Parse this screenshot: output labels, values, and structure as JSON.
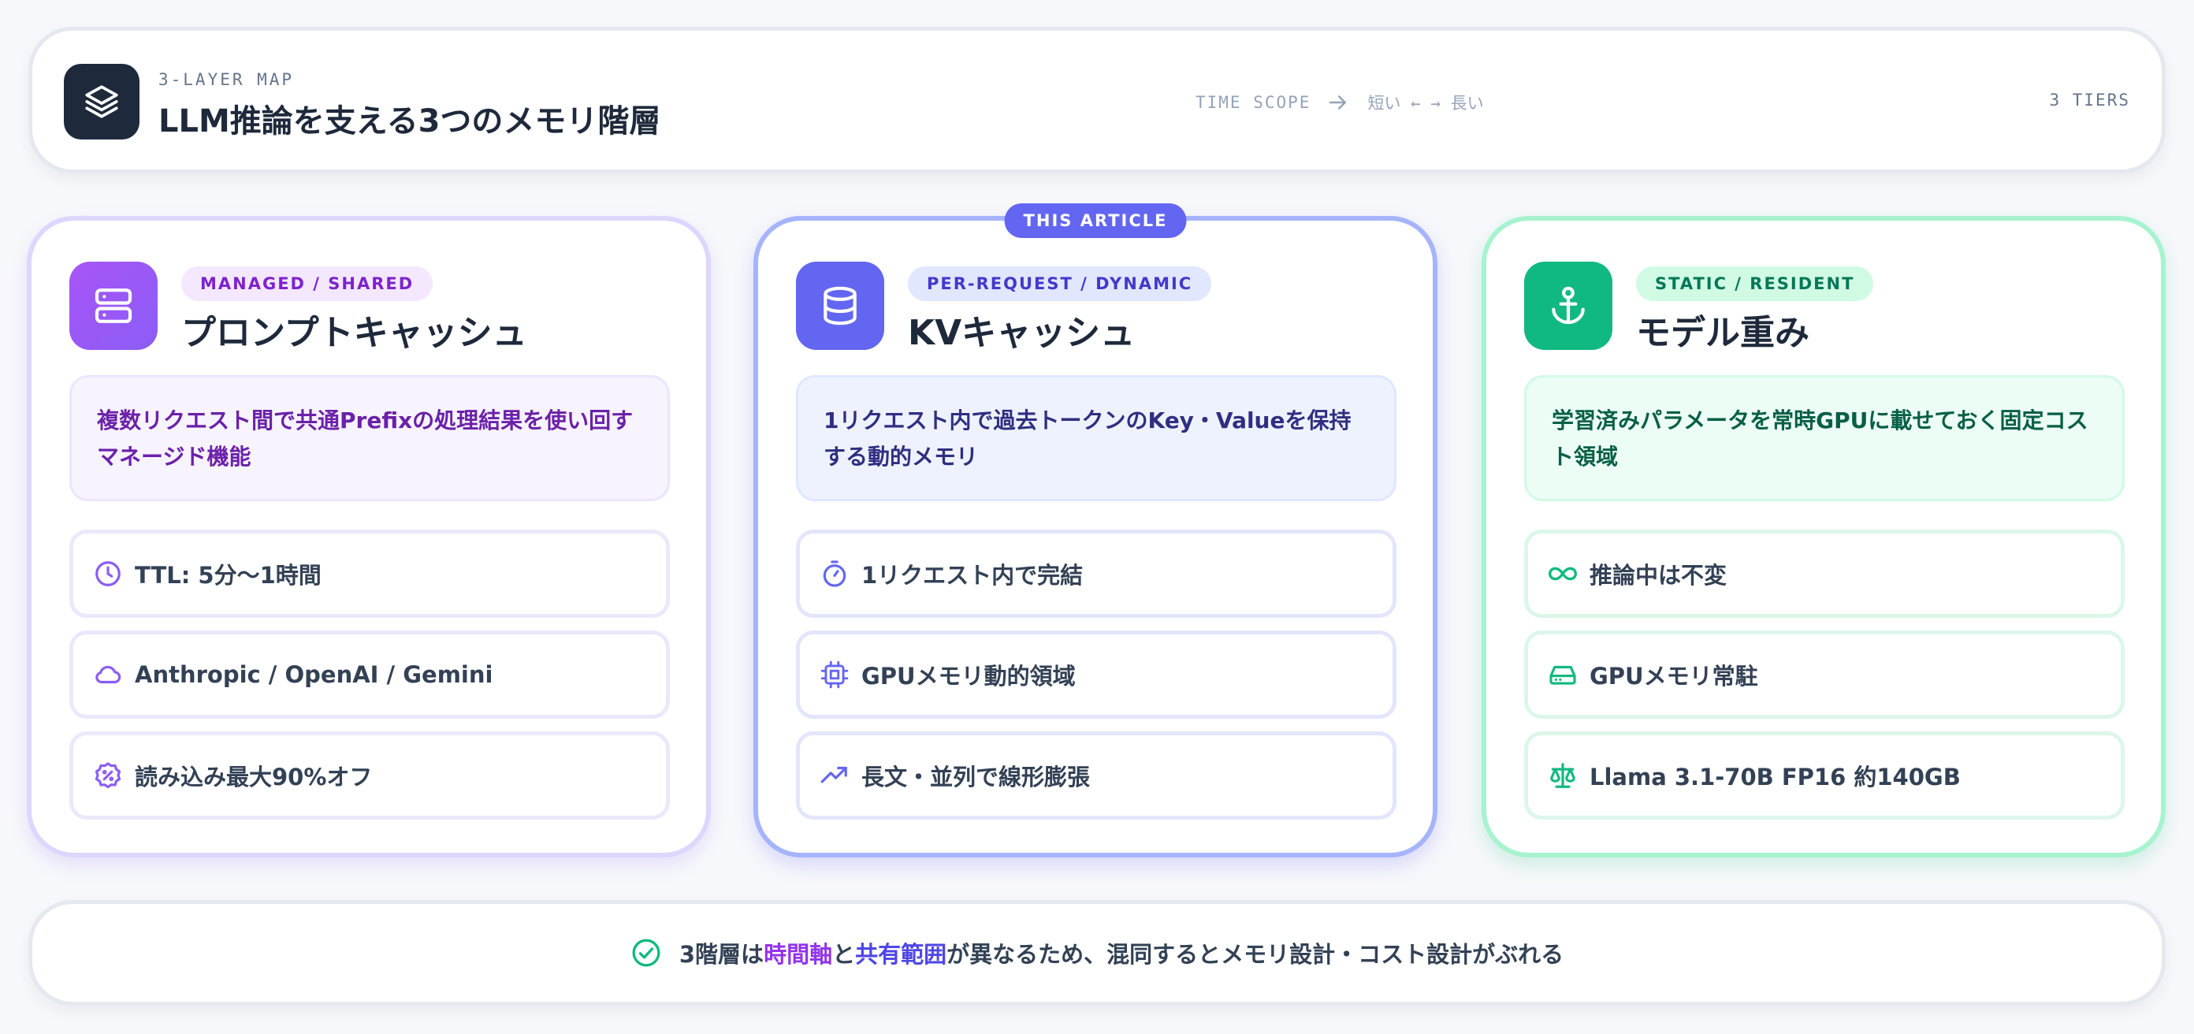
{
  "header": {
    "kicker": "3-LAYER MAP",
    "title": "LLM推論を支える3つのメモリ階層",
    "time_scope_label": "TIME SCOPE",
    "time_scope_range": "短い ← → 長い",
    "tiers": "3 TIERS"
  },
  "cards": [
    {
      "pill": "MANAGED / SHARED",
      "title": "プロンプトキャッシュ",
      "icon": "server-icon",
      "description": "複数リクエスト間で共通Prefixの処理結果を使い回すマネージド機能",
      "features": [
        {
          "icon": "clock-icon",
          "text": "TTL: 5分〜1時間"
        },
        {
          "icon": "cloud-icon",
          "text": "Anthropic / OpenAI / Gemini"
        },
        {
          "icon": "discount-icon",
          "text": "読み込み最大90%オフ"
        }
      ],
      "accent": "#8b5cf6"
    },
    {
      "flag": "THIS ARTICLE",
      "pill": "PER-REQUEST / DYNAMIC",
      "title": "KVキャッシュ",
      "icon": "database-icon",
      "description": "1リクエスト内で過去トークンのKey・Valueを保持する動的メモリ",
      "features": [
        {
          "icon": "timer-icon",
          "text": "1リクエスト内で完結"
        },
        {
          "icon": "chip-icon",
          "text": "GPUメモリ動的領域"
        },
        {
          "icon": "trending-up-icon",
          "text": "長文・並列で線形膨張"
        }
      ],
      "accent": "#6366f1"
    },
    {
      "pill": "STATIC / RESIDENT",
      "title": "モデル重み",
      "icon": "anchor-icon",
      "description": "学習済みパラメータを常時GPUに載せておく固定コスト領域",
      "features": [
        {
          "icon": "infinity-icon",
          "text": "推論中は不変"
        },
        {
          "icon": "hard-drive-icon",
          "text": "GPUメモリ常駐"
        },
        {
          "icon": "scale-icon",
          "text": "Llama 3.1-70B FP16 約140GB"
        }
      ],
      "accent": "#10b981"
    }
  ],
  "footer": {
    "part1": "3階層は",
    "highlight1": "時間軸",
    "part2": "と",
    "highlight2": "共有範囲",
    "part3": "が異なるため、混同するとメモリ設計・コスト設計がぶれる"
  }
}
